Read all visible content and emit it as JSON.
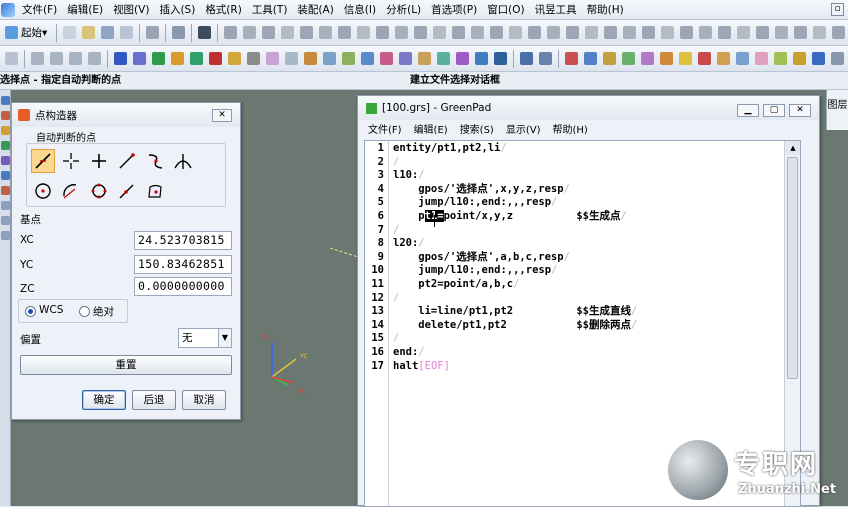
{
  "menubar": {
    "items": [
      "文件(F)",
      "编辑(E)",
      "视图(V)",
      "插入(S)",
      "格式(R)",
      "工具(T)",
      "装配(A)",
      "信息(I)",
      "分析(L)",
      "首选项(P)",
      "窗口(O)",
      "讯昱工具",
      "帮助(H)"
    ],
    "window_button": "▫"
  },
  "toolbar": {
    "start_label": "起始▾"
  },
  "statusbar": {
    "left": "选择点 - 指定自动判断的点",
    "center": "建立文件选择对话框"
  },
  "rightstrip": {
    "label": "图层"
  },
  "axes": {
    "zc": "ZC",
    "yc": "YC",
    "xc": "XC"
  },
  "dialog": {
    "title": "点构造器",
    "close": "✕",
    "auto_group": "自动判断的点",
    "base_point": "基点",
    "fields": [
      {
        "label": "XC",
        "value": "24.523703815"
      },
      {
        "label": "YC",
        "value": "150.83462851"
      },
      {
        "label": "ZC",
        "value": "0.0000000000"
      }
    ],
    "radio_wcs": "WCS",
    "radio_abs": "绝对",
    "offset_label": "偏置",
    "offset_value": "无",
    "reset": "重置",
    "ok": "确定",
    "back": "后退",
    "cancel": "取消"
  },
  "greenpad": {
    "title": "[100.grs] - GreenPad",
    "menu": [
      "文件(F)",
      "编辑(E)",
      "搜索(S)",
      "显示(V)",
      "帮助(H)"
    ],
    "lines": [
      "entity/pt1,pt2,li",
      "",
      "l10:",
      "    gpos/'选择点',x,y,z,resp",
      "    jump/l10:,end:,,,resp",
      "    pt1=point/x,y,z          $$生成点",
      "",
      "l20:",
      "    gpos/'选择点',a,b,c,resp",
      "    jump/l10:,end:,,,resp",
      "    pt2=point/a,b,c",
      "",
      "    li=line/pt1,pt2          $$生成直线",
      "    delete/pt1,pt2           $$删除两点",
      "",
      "end:",
      "halt"
    ],
    "eof": "[EOF]"
  },
  "watermark": {
    "cn": "专职网",
    "url": "Zhuanzhi.Net"
  },
  "colors": {
    "viewport_bg": "#6b7872",
    "accent": "#fbd891",
    "editor_bg": "#ffffff"
  }
}
